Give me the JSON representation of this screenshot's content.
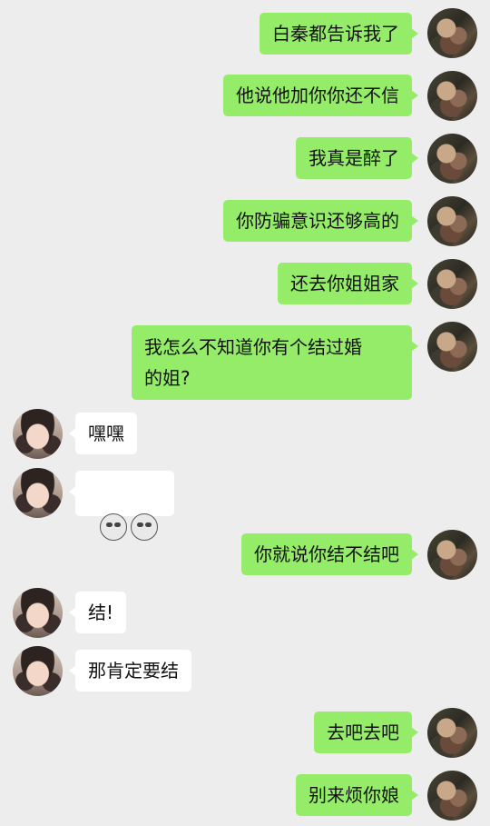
{
  "messages": [
    {
      "side": "me",
      "text": "白秦都告诉我了"
    },
    {
      "side": "me",
      "text": "他说他加你你还不信"
    },
    {
      "side": "me",
      "text": "我真是醉了"
    },
    {
      "side": "me",
      "text": "你防骗意识还够高的"
    },
    {
      "side": "me",
      "text": "还去你姐姐家"
    },
    {
      "side": "me",
      "text": "我怎么不知道你有个结过婚\n的姐?"
    },
    {
      "side": "other",
      "text": "嘿嘿"
    },
    {
      "side": "other",
      "emoji": "facepalm-emoji"
    },
    {
      "side": "me",
      "text": "你就说你结不结吧"
    },
    {
      "side": "other",
      "text": "结!"
    },
    {
      "side": "other",
      "text": "那肯定要结"
    },
    {
      "side": "me",
      "text": "去吧去吧"
    },
    {
      "side": "me",
      "text": "别来烦你娘"
    }
  ],
  "colors": {
    "background": "#ededed",
    "my_bubble": "#95ec69",
    "their_bubble": "#ffffff"
  }
}
